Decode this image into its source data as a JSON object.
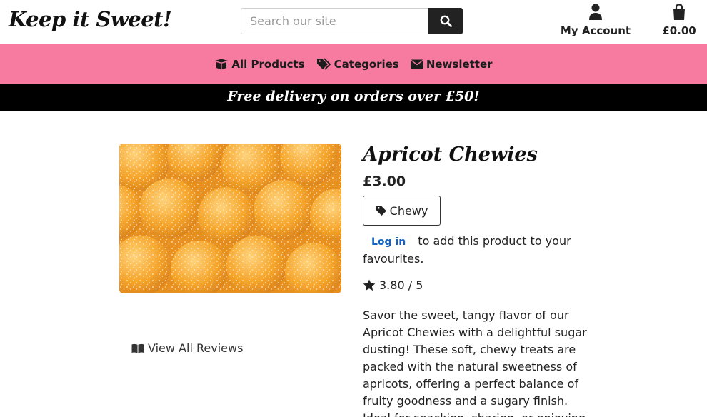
{
  "header": {
    "logo": "Keep it Sweet!",
    "search_placeholder": "Search our site",
    "account_label": "My Account",
    "cart_total": "£0.00"
  },
  "nav": {
    "items": [
      {
        "label": "All Products",
        "icon": "box-open-icon"
      },
      {
        "label": "Categories",
        "icon": "tags-icon"
      },
      {
        "label": "Newsletter",
        "icon": "envelope-icon"
      }
    ]
  },
  "promo": {
    "text": "Free delivery on orders over £50!"
  },
  "product": {
    "title": "Apricot Chewies",
    "price": "£3.00",
    "tag": "Chewy",
    "login_link": "Log in",
    "favourites_text": "to add this product to your favourites.",
    "rating": "3.80 / 5",
    "description": "Savor the sweet, tangy flavor of our Apricot Chewies with a delightful sugar dusting! These soft, chewy treats are packed with the natural sweetness of apricots, offering a perfect balance of fruity goodness and a sugary finish. Ideal for snacking, sharing, or enjoying",
    "reviews_link": "View All Reviews"
  },
  "colors": {
    "nav_background": "#f77aa0",
    "promo_background": "#000000",
    "link": "#1561c0",
    "candy": "#f6a52b"
  }
}
